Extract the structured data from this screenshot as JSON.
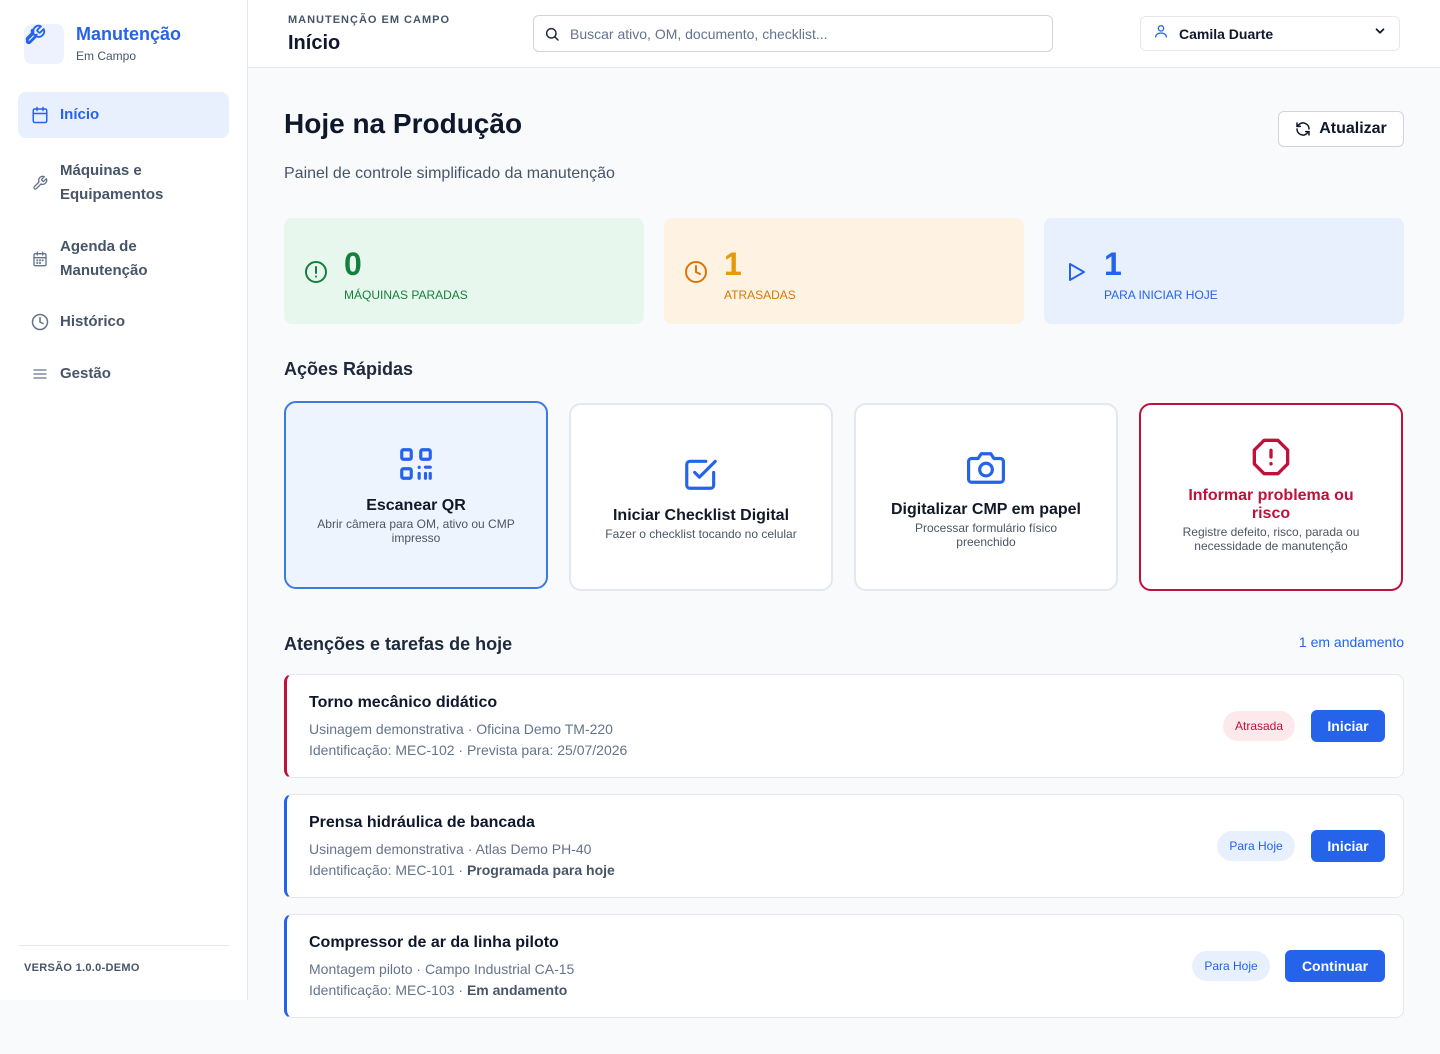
{
  "sidebar": {
    "brand_title": "Manutenção",
    "brand_sub": "Em Campo",
    "items": [
      {
        "label": "Início",
        "icon": "calendar-icon"
      },
      {
        "label": "Máquinas e Equipamentos",
        "icon": "wrench-icon"
      },
      {
        "label": "Agenda de Manutenção",
        "icon": "calendar-grid-icon"
      },
      {
        "label": "Histórico",
        "icon": "clock-icon"
      },
      {
        "label": "Gestão",
        "icon": "menu-icon"
      }
    ],
    "version": "VERSÃO 1.0.0-DEMO"
  },
  "header": {
    "overline": "MANUTENÇÃO EM CAMPO",
    "title": "Início",
    "search_placeholder": "Buscar ativo, OM, documento, checklist...",
    "user_name": "Camila Duarte"
  },
  "main": {
    "title": "Hoje na Produção",
    "subtitle": "Painel de controle simplificado da manutenção",
    "refresh_label": "Atualizar",
    "stats": [
      {
        "value": "0",
        "label": "MÁQUINAS PARADAS",
        "bg": "#e8f7ee",
        "color": "#15803d"
      },
      {
        "value": "1",
        "label": "ATRASADAS",
        "bg": "#fef3e2",
        "color": "#d97706"
      },
      {
        "value": "1",
        "label": "PARA INICIAR HOJE",
        "bg": "#e8f0fe",
        "color": "#2563eb"
      }
    ],
    "quick_title": "Ações Rápidas",
    "actions": [
      {
        "title": "Escanear QR",
        "desc": "Abrir câmera para OM, ativo ou CMP impresso"
      },
      {
        "title": "Iniciar Checklist Digital",
        "desc": "Fazer o checklist tocando no celular"
      },
      {
        "title": "Digitalizar CMP em papel",
        "desc": "Processar formulário físico preenchido"
      },
      {
        "title": "Informar problema ou risco",
        "desc": "Registre defeito, risco, parada ou necessidade de manutenção"
      }
    ],
    "tasks_title": "Atenções e tarefas de hoje",
    "tasks_link": "1 em andamento",
    "tasks": [
      {
        "title": "Torno mecânico didático",
        "line1": "Usinagem demonstrativa · Oficina Demo TM-220",
        "line2_prefix": "Identificação: MEC-102 · ",
        "line2_strong": "Prevista para: 25/07/2026",
        "badge": "Atrasada",
        "button": "Iniciar"
      },
      {
        "title": "Prensa hidráulica de bancada",
        "line1": "Usinagem demonstrativa · Atlas Demo PH-40",
        "line2_prefix": "Identificação: MEC-101 · ",
        "line2_strong": "Programada para hoje",
        "badge": "Para Hoje",
        "button": "Iniciar"
      },
      {
        "title": "Compressor de ar da linha piloto",
        "line1": "Montagem piloto · Campo Industrial CA-15",
        "line2_prefix": "Identificação: MEC-103 · ",
        "line2_strong": "Em andamento",
        "badge": "Para Hoje",
        "button": "Continuar"
      }
    ]
  },
  "colors": {
    "accent": "#2563eb",
    "danger": "#be123c",
    "success": "#15803d",
    "warning": "#d97706"
  }
}
